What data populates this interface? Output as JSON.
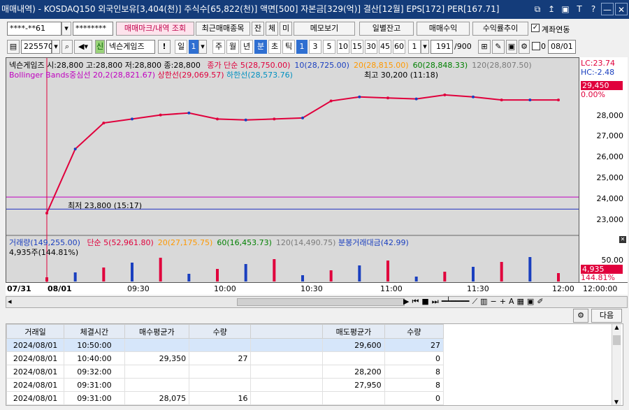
{
  "window": {
    "title": "매매내역) - KOSDAQ150 외국인보유[3,404(천)] 주식수[65,822(천)] 액면[500] 자본금[329(억)] 결산[12월] EPS[172] PER[167.71]",
    "title_btns": [
      "⧉",
      "↥",
      "▣",
      "T",
      "?"
    ],
    "min": "—",
    "close": "✕"
  },
  "toolbar1": {
    "account": "****-**61",
    "password": "********",
    "buttons": [
      "매매마크/내역 조회",
      "최근매매종목",
      "잔",
      "체",
      "미",
      "메모보기",
      "일별잔고",
      "매매수익",
      "수익률추이"
    ],
    "checkbox_label": "계좌연동"
  },
  "toolbar2": {
    "code": "225570",
    "name": "넥슨게임즈",
    "badge": "신",
    "bang": "!",
    "period_select": "일",
    "period_num": "1",
    "periods": [
      "주",
      "월",
      "년",
      "분",
      "초",
      "틱"
    ],
    "intervals": [
      "1",
      "3",
      "5",
      "10",
      "15",
      "30",
      "45",
      "60"
    ],
    "count_select": "1",
    "count": "191",
    "count_total": "/900",
    "check_zero": "0",
    "date": "08/01"
  },
  "chart": {
    "header": "넥슨게임즈 시:28,800 고:28,800 저:28,800 종:28,800",
    "ma_labels": [
      {
        "text": "종가 단순 5(28,750.00)",
        "color": "#e0003c"
      },
      {
        "text": "10(28,725.00)",
        "color": "#1a3fbf"
      },
      {
        "text": "20(28,815.00)",
        "color": "#ff9900"
      },
      {
        "text": "60(28,848.33)",
        "color": "#008000"
      },
      {
        "text": "120(28,807.50)",
        "color": "#7a7a7a"
      }
    ],
    "bb_label": "Bollinger Bands중심선 20,2(28,821.67)",
    "bb_upper": "상한선(29,069.57)",
    "bb_lower": "하한선(28,573.76)",
    "lc": "LC:23.74",
    "hc": "HC:-2.48",
    "current_price": "29,450",
    "current_pct": "0.00%",
    "low_note": "최저 23,800 (15:17)",
    "high_note": "최고 30,200 (11:18)",
    "y_ticks": [
      "28,000",
      "27,000",
      "26,000",
      "25,000",
      "24,000",
      "23,000"
    ],
    "volume_header": "거래량(149,255.00)",
    "volume_ma": [
      {
        "text": "단순 5(52,961.80)",
        "color": "#e0003c"
      },
      {
        "text": "20(27,175.75)",
        "color": "#ff9900"
      },
      {
        "text": "60(16,453.73)",
        "color": "#008000"
      },
      {
        "text": "120(14,490.75)",
        "color": "#7a7a7a"
      }
    ],
    "volume_amount": "분봉거래대금(42.99)",
    "volume_sub": "4,935주(144.81%)",
    "vol_ticks": [
      "50.00"
    ],
    "vol_current": "4,935",
    "vol_pct": "144.81%",
    "time_labels": [
      "07/31",
      "08/01",
      "09:30",
      "10:00",
      "10:30",
      "11:00",
      "11:30",
      "12:00",
      "12:00:00"
    ]
  },
  "bottom": {
    "next_btn": "다음",
    "columns": [
      "거래일",
      "체결시간",
      "매수평균가",
      "수량",
      "",
      "매도평균가",
      "수량"
    ],
    "rows": [
      [
        "2024/08/01",
        "10:50:00",
        "",
        "",
        "",
        "29,600",
        "27"
      ],
      [
        "2024/08/01",
        "10:40:00",
        "29,350",
        "27",
        "",
        "",
        "0"
      ],
      [
        "2024/08/01",
        "09:32:00",
        "",
        "",
        "",
        "28,200",
        "8"
      ],
      [
        "2024/08/01",
        "09:31:00",
        "",
        "",
        "",
        "27,950",
        "8"
      ],
      [
        "2024/08/01",
        "09:31:00",
        "28,075",
        "16",
        "",
        "",
        "0"
      ]
    ]
  },
  "chart_data": {
    "type": "line",
    "x": [
      "08/01 09:00",
      "09:10",
      "09:20",
      "09:30",
      "09:40",
      "09:50",
      "10:00",
      "10:10",
      "10:20",
      "10:30",
      "10:40",
      "10:50",
      "11:00",
      "11:10",
      "11:20",
      "11:30",
      "11:40",
      "11:50",
      "12:00"
    ],
    "series": [
      {
        "name": "종가",
        "values": [
          23800,
          27000,
          28300,
          28500,
          28700,
          28800,
          28500,
          28450,
          28500,
          28550,
          29400,
          29600,
          29550,
          29500,
          29700,
          29600,
          29450,
          29450,
          29450
        ]
      }
    ],
    "ylim": [
      23000,
      30500
    ]
  }
}
